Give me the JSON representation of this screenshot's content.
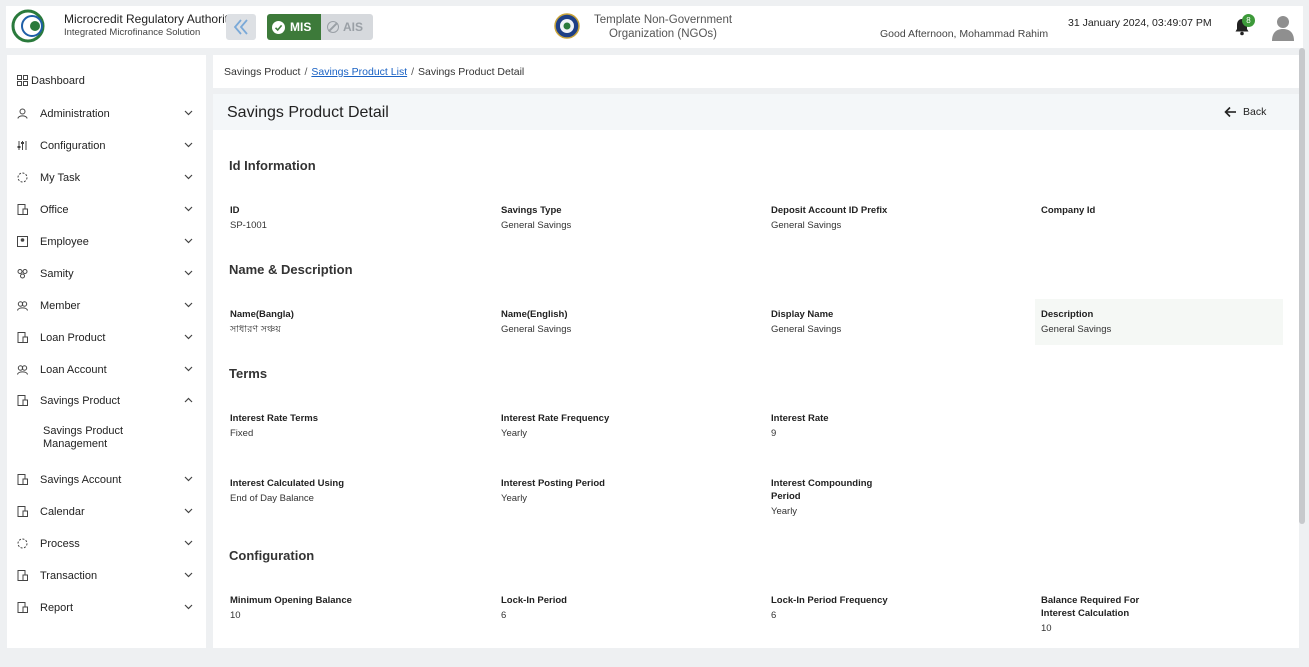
{
  "header": {
    "brand_name": "Microcredit Regulatory Authority",
    "brand_sub": "Integrated Microfinance Solution",
    "toggle": {
      "mis": "MIS",
      "ais": "AIS"
    },
    "org_name": "Template Non-Government Organization (NGOs)",
    "greeting": "Good Afternoon, Mohammad Rahim",
    "datetime": "31 January 2024, 03:49:07 PM",
    "notification_count": "8",
    "colors": {
      "mis_active": "#3d7a3a",
      "badge": "#3d9a3a",
      "link": "#1a62c4"
    }
  },
  "sidebar": {
    "dashboard": "Dashboard",
    "items": [
      {
        "label": "Administration",
        "icon": "admin-icon"
      },
      {
        "label": "Configuration",
        "icon": "sliders-icon"
      },
      {
        "label": "My Task",
        "icon": "task-icon"
      },
      {
        "label": "Office",
        "icon": "office-icon"
      },
      {
        "label": "Employee",
        "icon": "employee-icon"
      },
      {
        "label": "Samity",
        "icon": "samity-icon"
      },
      {
        "label": "Member",
        "icon": "member-icon"
      },
      {
        "label": "Loan Product",
        "icon": "document-icon"
      },
      {
        "label": "Loan Account",
        "icon": "account-icon"
      },
      {
        "label": "Savings Product",
        "icon": "document-icon"
      },
      {
        "label": "Savings Account",
        "icon": "document-icon"
      },
      {
        "label": "Calendar",
        "icon": "calendar-icon"
      },
      {
        "label": "Process",
        "icon": "process-icon"
      },
      {
        "label": "Transaction",
        "icon": "transaction-icon"
      },
      {
        "label": "Report",
        "icon": "report-icon"
      }
    ],
    "expanded_sub": "Savings Product Management"
  },
  "breadcrumb": {
    "root": "Savings Product",
    "list": "Savings Product List",
    "current": "Savings Product Detail"
  },
  "page": {
    "title": "Savings Product Detail",
    "back_label": "Back"
  },
  "sections": {
    "id_info": {
      "title": "Id Information",
      "fields": [
        {
          "label": "ID",
          "value": "SP-1001"
        },
        {
          "label": "Savings Type",
          "value": "General Savings"
        },
        {
          "label": "Deposit Account ID Prefix",
          "value": "General Savings"
        },
        {
          "label": "Company Id",
          "value": ""
        }
      ]
    },
    "name_desc": {
      "title": "Name & Description",
      "fields": [
        {
          "label": "Name(Bangla)",
          "value": "সাধারণ সঞ্চয়"
        },
        {
          "label": "Name(English)",
          "value": "General Savings"
        },
        {
          "label": "Display Name",
          "value": "General Savings"
        },
        {
          "label": "Description",
          "value": "General Savings"
        }
      ]
    },
    "terms": {
      "title": "Terms",
      "fields": [
        {
          "label": "Interest Rate Terms",
          "value": "Fixed"
        },
        {
          "label": "Interest Rate Frequency",
          "value": "Yearly"
        },
        {
          "label": "Interest Rate",
          "value": "9"
        },
        {
          "label": "Interest Calculated Using",
          "value": "End of Day Balance"
        },
        {
          "label": "Interest Posting Period",
          "value": "Yearly"
        },
        {
          "label": "Interest Compounding Period",
          "value": "Yearly"
        }
      ]
    },
    "config": {
      "title": "Configuration",
      "fields": [
        {
          "label": "Minimum Opening Balance",
          "value": "10"
        },
        {
          "label": "Lock-In Period",
          "value": "6"
        },
        {
          "label": "Lock-In Period Frequency",
          "value": "6"
        },
        {
          "label": "Balance Required For Interest Calculation",
          "value": "10"
        }
      ]
    }
  }
}
